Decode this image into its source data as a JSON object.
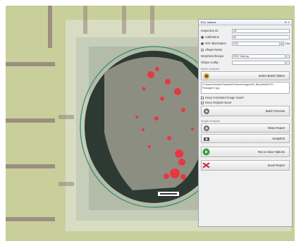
{
  "panel": {
    "title": "ECL Ireland",
    "controls": [
      "▾",
      "×"
    ],
    "fields": [
      {
        "label": "Inspection ID",
        "value": "28"
      },
      {
        "label": "Calibration",
        "value": "5x"
      },
      {
        "label": "ROI Illumination",
        "value": "225",
        "unit": "Um"
      },
      {
        "label": "Shape Name",
        "value": ""
      },
      {
        "label": "Morphotechnique",
        "value": "EHC Interop"
      },
      {
        "label": "Shape config",
        "value": ""
      }
    ],
    "batch_section": "Batch Analysis",
    "batch_button": "Select Batch folders",
    "path_text": "D:\\Users\\Hewlett-Packard\\Perforce\\Images\\Pic Results\\BATCH Packages\\*.jpg",
    "check_bmp": "Keep Annotated Image report",
    "check_orig": "Keep Original report",
    "batch_process": "Batch Process",
    "single_section": "Single Analysis",
    "single_buttons": [
      "Show Report",
      "Snapshot",
      "Run & Save Options",
      "Excel Report"
    ]
  }
}
